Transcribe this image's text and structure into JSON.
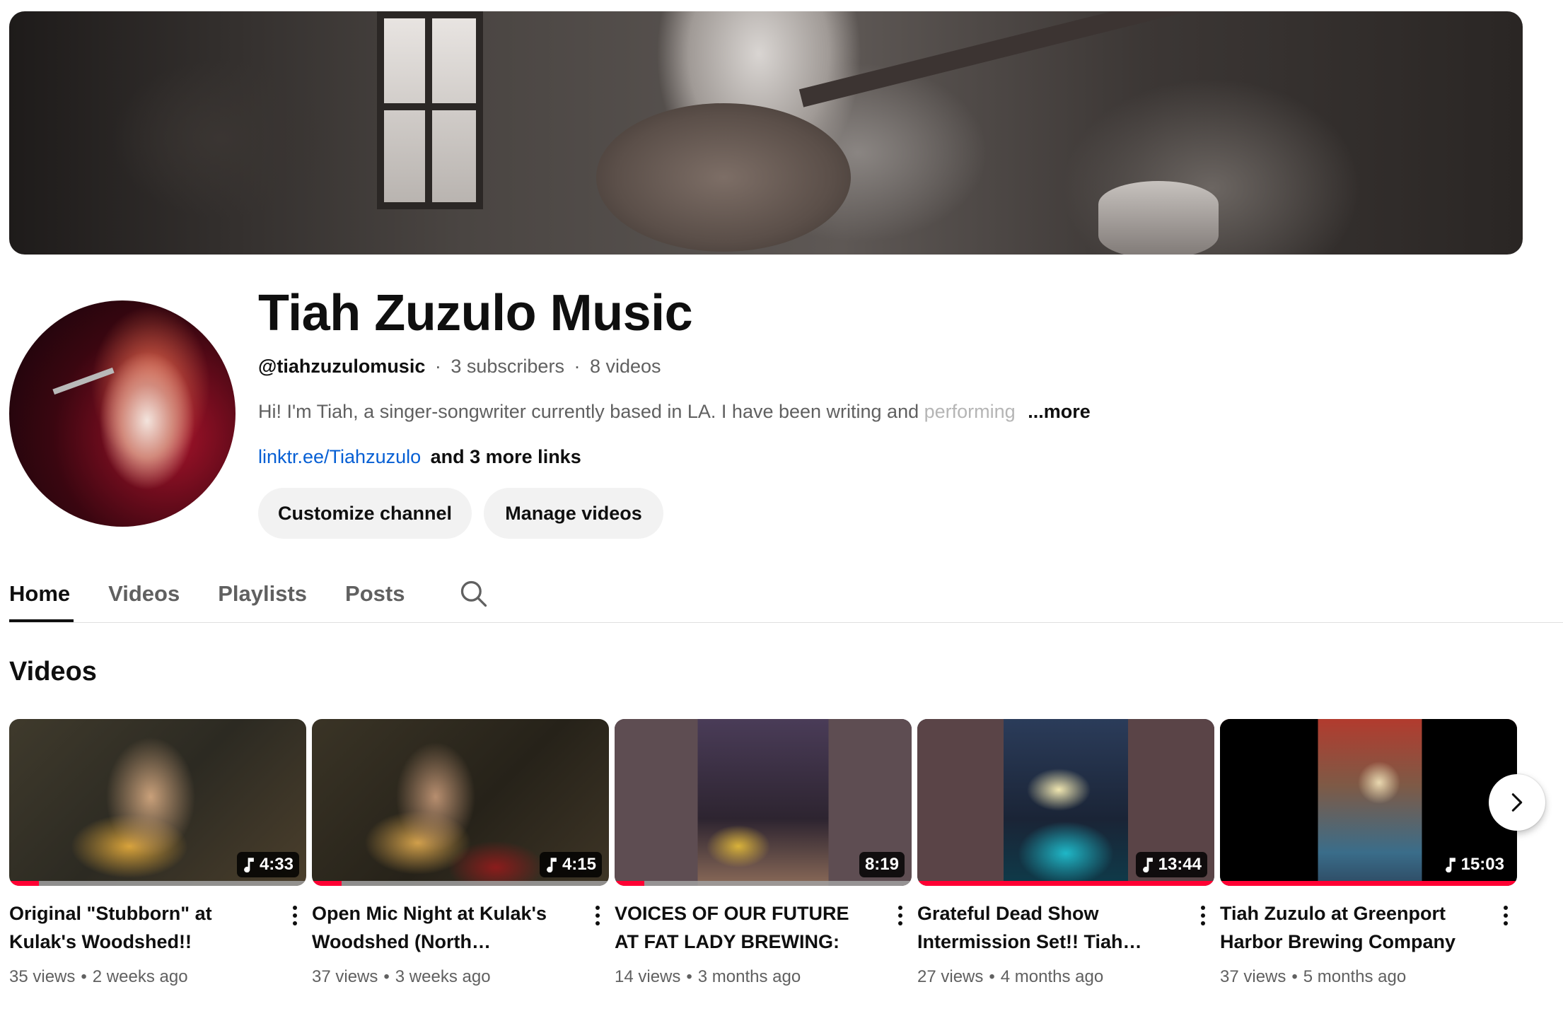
{
  "channel": {
    "name": "Tiah Zuzulo Music",
    "handle": "@tiahzuzulomusic",
    "subscribers": "3 subscribers",
    "video_count": "8 videos",
    "description": "Hi! I'm Tiah, a singer-songwriter currently based in LA. I have been writing and ",
    "description_faded": "performing",
    "more_label": "...more",
    "link": "linktr.ee/Tiahzuzulo",
    "more_links": "and 3 more links",
    "separator": "·"
  },
  "actions": {
    "customize": "Customize channel",
    "manage": "Manage videos"
  },
  "tabs": [
    {
      "label": "Home",
      "active": true
    },
    {
      "label": "Videos",
      "active": false
    },
    {
      "label": "Playlists",
      "active": false
    },
    {
      "label": "Posts",
      "active": false
    }
  ],
  "section_title": "Videos",
  "videos": [
    {
      "title": "Original \"Stubborn\" at Kulak's Woodshed!!",
      "duration": "4:33",
      "music_icon": true,
      "views": "35 views",
      "age": "2 weeks ago",
      "watched": 0.1
    },
    {
      "title": "Open Mic Night at Kulak's Woodshed (North…",
      "duration": "4:15",
      "music_icon": true,
      "views": "37 views",
      "age": "3 weeks ago",
      "watched": 0.1
    },
    {
      "title": "VOICES OF OUR FUTURE AT FAT LADY BREWING: A…",
      "duration": "8:19",
      "music_icon": false,
      "views": "14 views",
      "age": "3 months ago",
      "watched": 0.1
    },
    {
      "title": "Grateful Dead Show Intermission Set!! Tiah…",
      "duration": "13:44",
      "music_icon": true,
      "views": "27 views",
      "age": "4 months ago",
      "watched": 1.0
    },
    {
      "title": "Tiah Zuzulo at Greenport Harbor Brewing Company in…",
      "duration": "15:03",
      "music_icon": true,
      "views": "37 views",
      "age": "5 months ago",
      "watched": 1.0
    }
  ],
  "meta_separator": "•",
  "colors": {
    "accent": "#ff0033",
    "link": "#065fd4",
    "text": "#0f0f0f",
    "secondary": "#606060"
  },
  "icons": {
    "search": "search-icon",
    "next": "chevron-right-icon",
    "music": "music-note-icon",
    "menu": "more-vertical-icon"
  }
}
